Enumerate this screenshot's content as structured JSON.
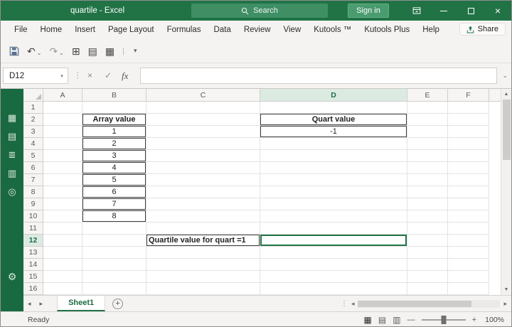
{
  "window": {
    "title": "quartile - Excel",
    "search_placeholder": "Search",
    "sign_in_label": "Sign in"
  },
  "menu": {
    "tabs": [
      "File",
      "Home",
      "Insert",
      "Page Layout",
      "Formulas",
      "Data",
      "Review",
      "View",
      "Kutools ™",
      "Kutools Plus",
      "Help"
    ],
    "share_label": "Share"
  },
  "formula_bar": {
    "name_box_value": "D12",
    "fx_label": "fx",
    "formula_value": ""
  },
  "grid": {
    "column_headers": [
      "A",
      "B",
      "C",
      "D",
      "E",
      "F"
    ],
    "row_headers": [
      "1",
      "2",
      "3",
      "4",
      "5",
      "6",
      "7",
      "8",
      "9",
      "10",
      "11",
      "12",
      "13",
      "14",
      "15",
      "16"
    ],
    "selected_cell": "D12",
    "selected_column": "D",
    "selected_row": "12",
    "cells": [
      {
        "ref": "B2",
        "text": "Array value",
        "bold": true,
        "border": true,
        "align": "center"
      },
      {
        "ref": "B3",
        "text": "1",
        "border": true,
        "align": "center"
      },
      {
        "ref": "B4",
        "text": "2",
        "border": true,
        "align": "center"
      },
      {
        "ref": "B5",
        "text": "3",
        "border": true,
        "align": "center"
      },
      {
        "ref": "B6",
        "text": "4",
        "border": true,
        "align": "center"
      },
      {
        "ref": "B7",
        "text": "5",
        "border": true,
        "align": "center"
      },
      {
        "ref": "B8",
        "text": "6",
        "border": true,
        "align": "center"
      },
      {
        "ref": "B9",
        "text": "7",
        "border": true,
        "align": "center"
      },
      {
        "ref": "B10",
        "text": "8",
        "border": true,
        "align": "center"
      },
      {
        "ref": "D2",
        "text": "Quart value",
        "bold": true,
        "border": true,
        "align": "center"
      },
      {
        "ref": "D3",
        "text": "-1",
        "border": true,
        "align": "center"
      },
      {
        "ref": "C12",
        "text": "Quartile value for quart =1",
        "bold": true,
        "border": true,
        "align": "left"
      },
      {
        "ref": "D12",
        "text": "",
        "border": true,
        "align": "center",
        "selected": true
      }
    ]
  },
  "sheet_bar": {
    "active_tab": "Sheet1"
  },
  "status_bar": {
    "status": "Ready",
    "zoom_level": "100%"
  },
  "icons": {
    "close": "×",
    "cancel": "×",
    "enter": "✓",
    "undo": "↶",
    "redo": "↷",
    "caret_down": "⌄",
    "dropdown": "▾",
    "qat_table": "⊞",
    "qat_form": "▤",
    "qat_grid": "▦",
    "more_dots": "⋮",
    "scroll_up": "▲",
    "scroll_down": "▼",
    "sheet_prev": "◂",
    "sheet_next": "▸",
    "add_sheet": "+",
    "sidebar": [
      "▦",
      "▤",
      "≣",
      "▥",
      "◎"
    ],
    "gear": "⚙",
    "view_normal": "▦",
    "view_layout": "▤",
    "view_break": "▥",
    "zoom_out": "—",
    "zoom_in": "+"
  }
}
